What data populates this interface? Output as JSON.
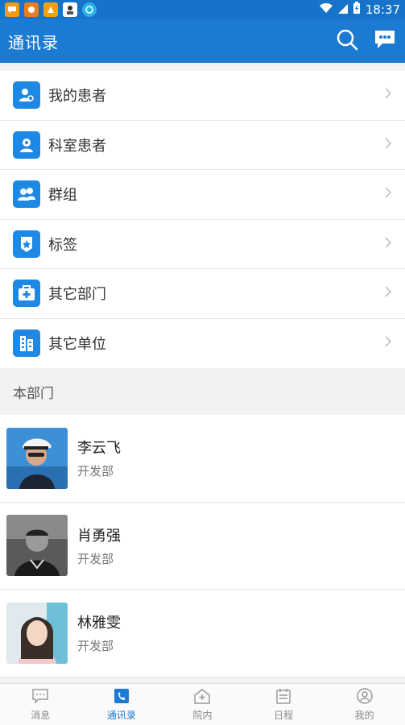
{
  "status_bar": {
    "time": "18:37",
    "notification_icons": [
      "chat-notification-icon",
      "game-notification-icon",
      "app-notification-icon",
      "avatar-notification-icon",
      "browser-notification-icon"
    ],
    "icons": [
      "wifi-icon",
      "signal-icon",
      "battery-icon"
    ]
  },
  "app_bar": {
    "title": "通讯录",
    "icons": [
      "search-icon",
      "message-icon"
    ]
  },
  "menu": {
    "items": [
      {
        "label": "我的患者",
        "icon": "my-patients-icon"
      },
      {
        "label": "科室患者",
        "icon": "department-patients-icon"
      },
      {
        "label": "群组",
        "icon": "group-icon"
      },
      {
        "label": "标签",
        "icon": "tag-icon"
      },
      {
        "label": "其它部门",
        "icon": "other-department-icon"
      },
      {
        "label": "其它单位",
        "icon": "other-unit-icon"
      }
    ]
  },
  "section": {
    "title": "本部门"
  },
  "contacts": [
    {
      "name": "李云飞",
      "dept": "开发部"
    },
    {
      "name": "肖勇强",
      "dept": "开发部"
    },
    {
      "name": "林雅雯",
      "dept": "开发部"
    }
  ],
  "bottom_nav": {
    "items": [
      {
        "label": "消息",
        "icon": "message-icon"
      },
      {
        "label": "通讯录",
        "icon": "contacts-icon",
        "active": true
      },
      {
        "label": "院内",
        "icon": "hospital-icon"
      },
      {
        "label": "日程",
        "icon": "calendar-icon"
      },
      {
        "label": "我的",
        "icon": "profile-icon"
      }
    ]
  },
  "colors": {
    "primary": "#1b7ad2",
    "icon_bg": "#1e88e5",
    "background": "#f2f2f2"
  }
}
